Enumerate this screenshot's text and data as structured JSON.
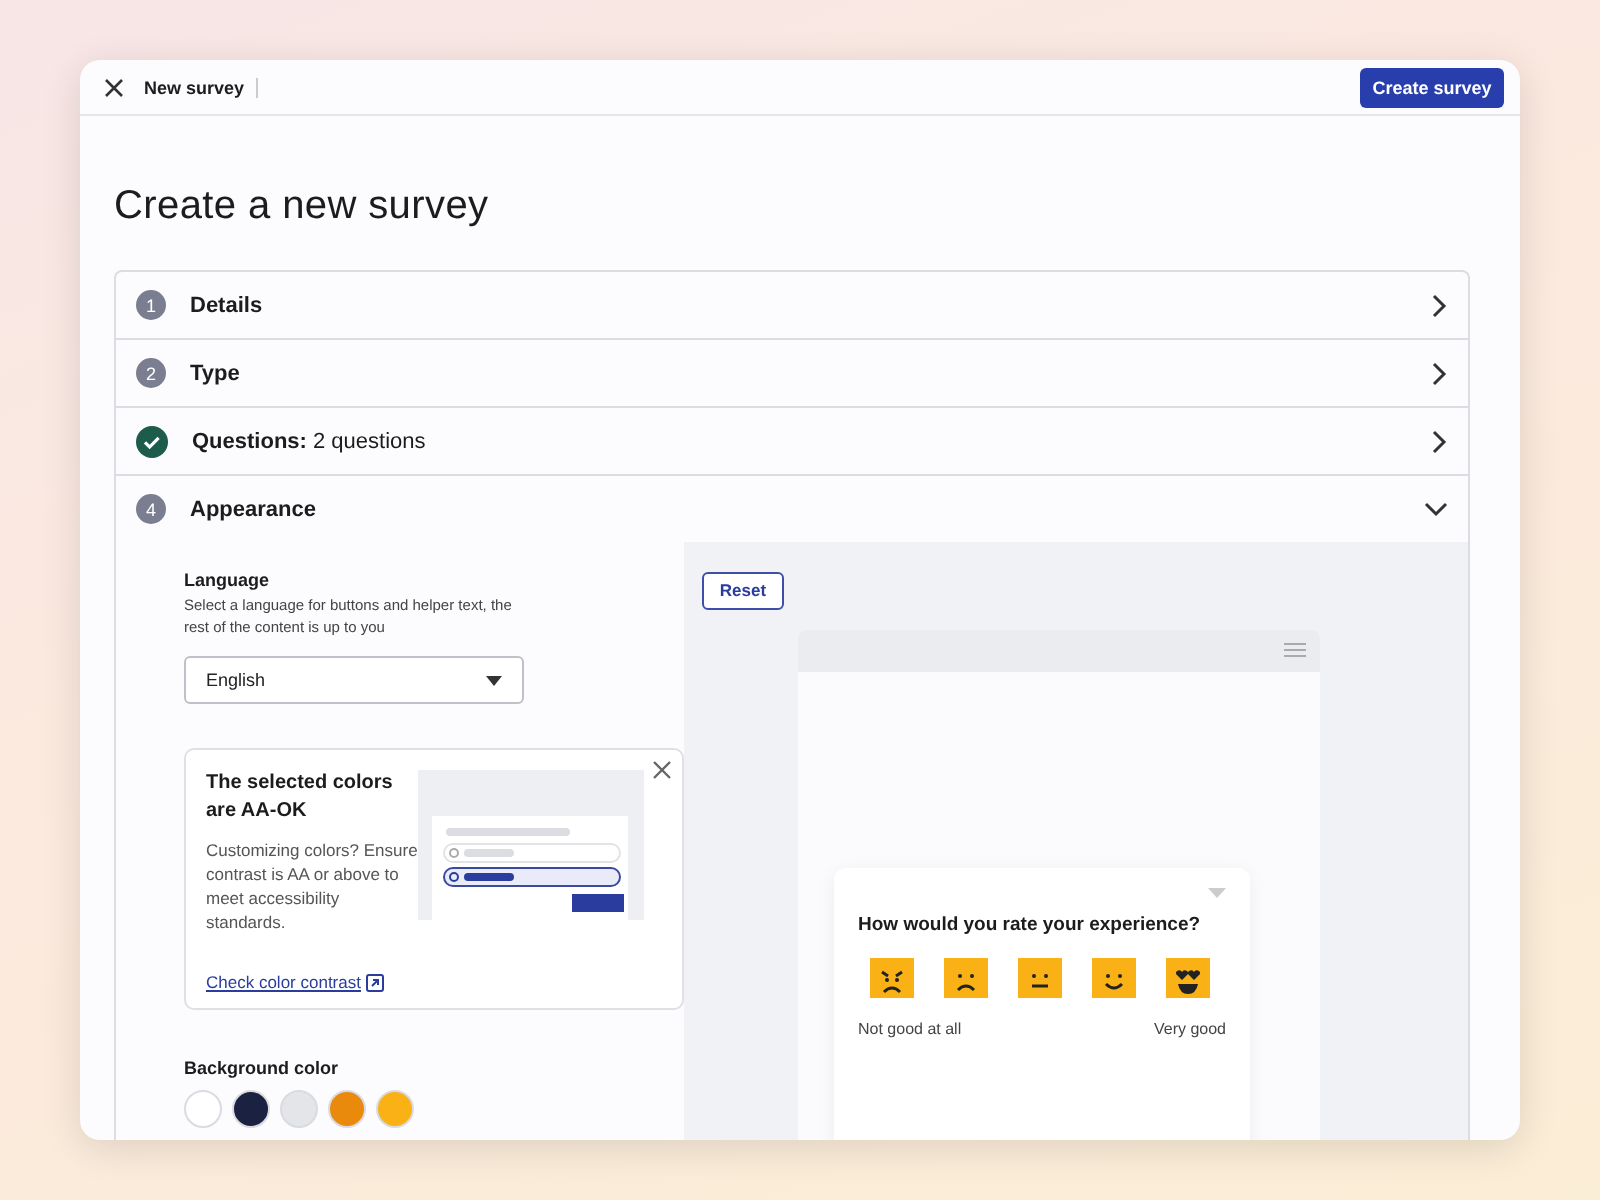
{
  "header": {
    "title": "New survey",
    "primary_button": "Create survey"
  },
  "page_title": "Create a new survey",
  "steps": [
    {
      "kind": "number",
      "badge": "1",
      "label": "Details",
      "expanded": false
    },
    {
      "kind": "number",
      "badge": "2",
      "label": "Type",
      "expanded": false
    },
    {
      "kind": "done",
      "label": "**Questions:** 2 questions",
      "expanded": false
    },
    {
      "kind": "number",
      "badge": "4",
      "label": "Appearance",
      "expanded": true
    }
  ],
  "appearance": {
    "language": {
      "label": "Language",
      "help": "Select a language for buttons and helper text, the rest of the content is up to you",
      "value": "English"
    },
    "tip": {
      "title": "The selected colors are AA-OK",
      "body": "Customizing colors? Ensure contrast is AA or above to meet accessibility standards.",
      "link": "Check color contrast"
    },
    "background": {
      "label": "Background color",
      "swatches": [
        {
          "color": "#ffffff"
        },
        {
          "color": "#1b2140"
        },
        {
          "color": "#e4e5e8"
        },
        {
          "color": "#e98a0c"
        },
        {
          "color": "#f9b115"
        }
      ]
    },
    "preview": {
      "reset": "Reset",
      "question": "How would you rate your experience?",
      "faces": [
        {
          "kind": "angry"
        },
        {
          "kind": "sad"
        },
        {
          "kind": "neutral"
        },
        {
          "kind": "happy"
        },
        {
          "kind": "love"
        }
      ],
      "low_label": "Not good at all",
      "high_label": "Very good"
    }
  }
}
